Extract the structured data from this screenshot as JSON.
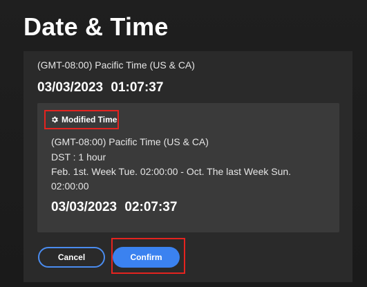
{
  "page": {
    "title": "Date & Time"
  },
  "current": {
    "timezone": "(GMT-08:00) Pacific Time (US & CA)",
    "datetime": "03/03/2023  01:07:37"
  },
  "modified": {
    "label": "Modified Time",
    "icon": "gear-icon",
    "timezone": "(GMT-08:00) Pacific Time (US & CA)",
    "dst": "DST : 1 hour",
    "dst_range_line1": "Feb. 1st. Week Tue. 02:00:00 - Oct. The last Week Sun.",
    "dst_range_line2": "02:00:00",
    "datetime": "03/03/2023  02:07:37"
  },
  "actions": {
    "cancel_label": "Cancel",
    "confirm_label": "Confirm"
  },
  "colors": {
    "accent": "#3b82f0",
    "highlight": "#e5231f"
  }
}
